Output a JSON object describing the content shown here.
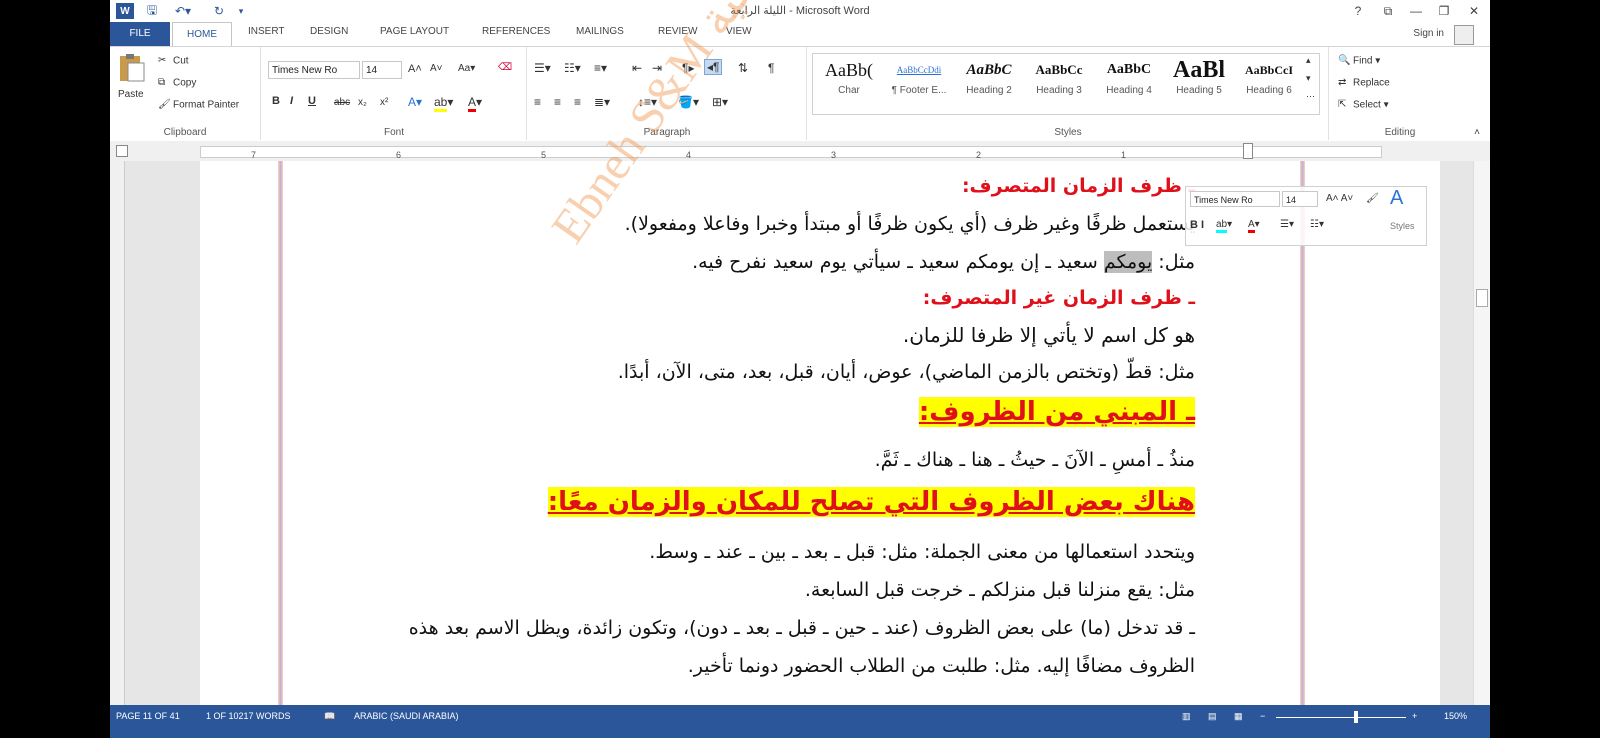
{
  "window": {
    "title": "الليلة الرابعة - Microsoft Word",
    "controls": [
      "?",
      "⧉",
      "—",
      "❐",
      "✕"
    ]
  },
  "tabs": [
    "FILE",
    "HOME",
    "INSERT",
    "DESIGN",
    "PAGE LAYOUT",
    "REFERENCES",
    "MAILINGS",
    "REVIEW",
    "VIEW"
  ],
  "sign_in": "Sign in",
  "clipboard": {
    "paste": "Paste",
    "cut": "Cut",
    "copy": "Copy",
    "format_painter": "Format Painter",
    "label": "Clipboard"
  },
  "font": {
    "name": "Times New Ro",
    "size": "14",
    "label": "Font"
  },
  "paragraph": {
    "label": "Paragraph"
  },
  "styles": {
    "label": "Styles",
    "items": [
      {
        "sample": "AaBb(",
        "name": "Char"
      },
      {
        "sample": "AaBbCcDdi",
        "name": "¶ Footer E..."
      },
      {
        "sample": "AaBbC",
        "name": "Heading 2"
      },
      {
        "sample": "AaBbCc",
        "name": "Heading 3"
      },
      {
        "sample": "AaBbC",
        "name": "Heading 4"
      },
      {
        "sample": "AaBl",
        "name": "Heading 5"
      },
      {
        "sample": "AaBbCcI",
        "name": "Heading 6"
      }
    ]
  },
  "editing": {
    "find": "Find",
    "replace": "Replace",
    "select": "Select",
    "label": "Editing"
  },
  "ruler_numbers": [
    "7",
    "6",
    "5",
    "4",
    "3",
    "2",
    "1"
  ],
  "mini_toolbar": {
    "font": "Times New Ro",
    "size": "14",
    "styles": "Styles"
  },
  "document": {
    "l1": "ـ ظرف الزمان المتصرف:",
    "l2": "يستعمل ظرفًا وغير ظرف (أي يكون ظرفًا أو مبتدأ وخبرا وفاعلا ومفعولا).",
    "l3_a": "مثل: ",
    "l3_sel": "يومكم",
    "l3_b": " سعيد ـ إن يومكم سعيد ـ سيأتي يوم سعيد نفرح فيه.",
    "l4": "ـ ظرف الزمان غير المتصرف:",
    "l5": "هو كل اسم لا يأتي إلا ظرفا للزمان.",
    "l6": "مثل: قطّ (وتختص بالزمن الماضي)، عوض، أيان، قبل، بعد، متى، الآن، أبدًا.",
    "l7": "ـ المبني من الظروف:",
    "l8": "منذُ ـ أمسِ ـ الآنَ ـ حيثُ ـ هنا ـ هناك ـ ثَمَّ.",
    "l9": "هناك بعض الظروف التي تصلح للمكان والزمان معًا:",
    "l10": "ويتحدد استعمالها من معنى الجملة: مثل: قبل ـ بعد ـ بين ـ عند ـ وسط.",
    "l11": "مثل: يقع منزلنا قبل منزلكم ـ خرجت قبل السابعة.",
    "l12": "ـ قد تدخل (ما) على بعض الظروف (عند ـ حين ـ قبل ـ بعد ـ دون)، وتكون زائدة، ويظل الاسم بعد هذه",
    "l13": "الظروف مضافًا إليه. مثل: طلبت من الطلاب الحضور دونما تأخير."
  },
  "watermark": "Ebneh S&M الدراسية",
  "status": {
    "page": "PAGE 11 OF 41",
    "words": "1 OF 10217 WORDS",
    "lang": "ARABIC (SAUDI ARABIA)",
    "zoom": "150%"
  }
}
